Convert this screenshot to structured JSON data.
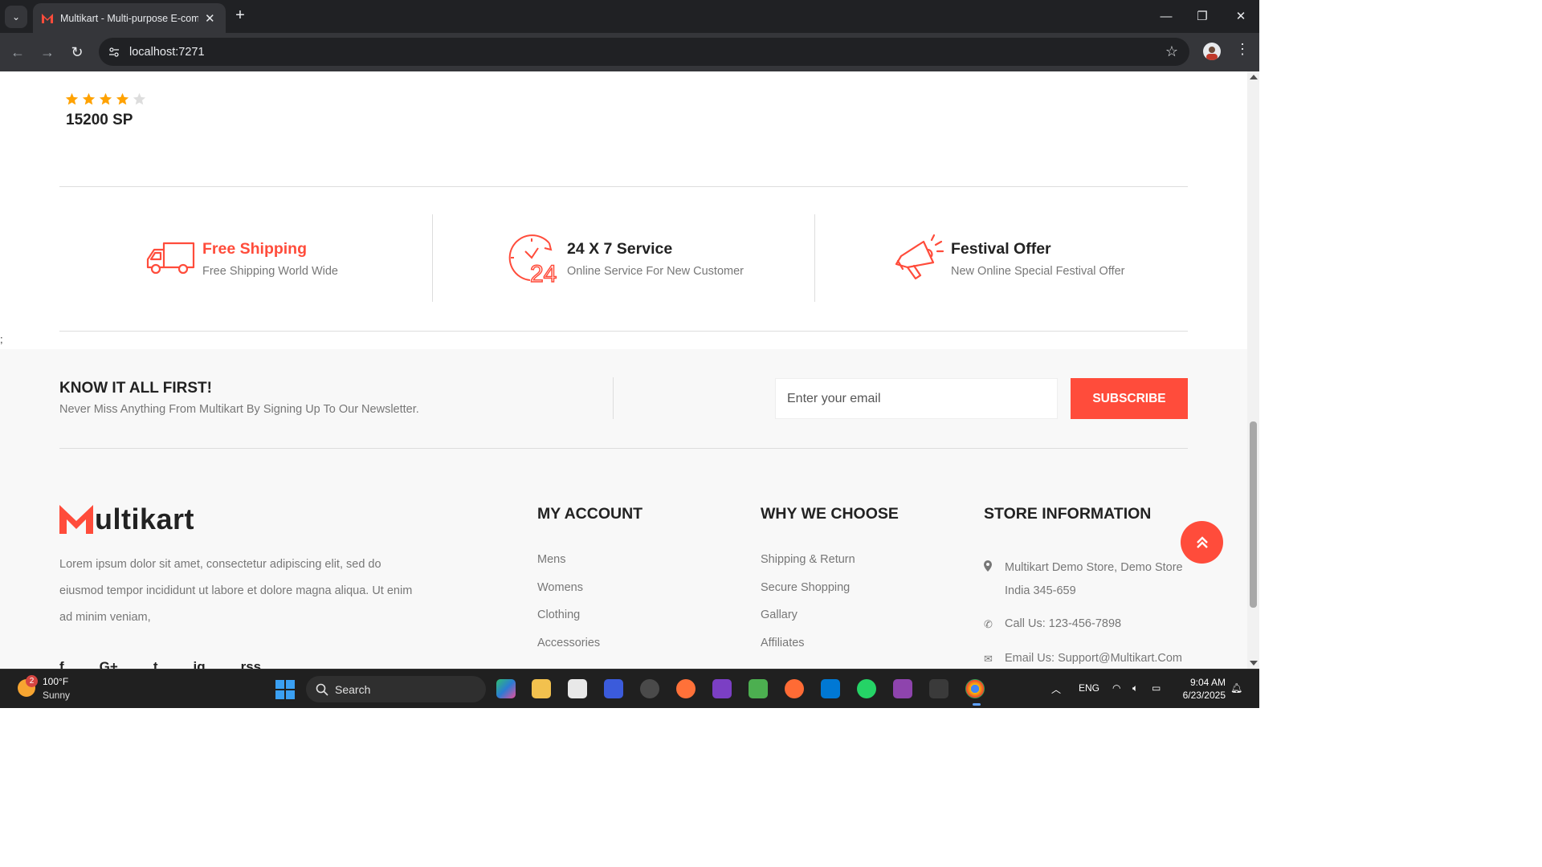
{
  "browser": {
    "tab_title": "Multikart - Multi-purpose E-commerce",
    "url": "localhost:7271",
    "tab_close": "✕",
    "new_tab": "+",
    "minimize": "—",
    "restore": "❐",
    "close": "✕"
  },
  "product": {
    "rating": 4,
    "max_rating": 5,
    "price": "15200 SP",
    "star_color": "#ffa200"
  },
  "services": [
    {
      "title": "Free Shipping",
      "desc": "Free Shipping World Wide",
      "icon": "truck-icon"
    },
    {
      "title": "24 X 7 Service",
      "desc": "Online Service For New Customer",
      "icon": "clock-24-icon"
    },
    {
      "title": "Festival Offer",
      "desc": "New Online Special Festival Offer",
      "icon": "megaphone-icon"
    }
  ],
  "stray_text": ";",
  "newsletter": {
    "title": "KNOW IT ALL FIRST!",
    "text": "Never Miss Anything From Multikart By Signing Up To Our Newsletter.",
    "placeholder": "Enter your email",
    "button": "SUBSCRIBE"
  },
  "footer": {
    "logo_text": "ultikart",
    "about": "Lorem ipsum dolor sit amet, consectetur adipiscing elit, sed do eiusmod tempor incididunt ut labore et dolore magna aliqua. Ut enim ad minim veniam,",
    "socials": [
      "f",
      "G+",
      "t",
      "ig",
      "rss"
    ],
    "my_account": {
      "title": "MY ACCOUNT",
      "links": [
        "Mens",
        "Womens",
        "Clothing",
        "Accessories"
      ]
    },
    "why_we_choose": {
      "title": "WHY WE CHOOSE",
      "links": [
        "Shipping & Return",
        "Secure Shopping",
        "Gallary",
        "Affiliates"
      ]
    },
    "store_info": {
      "title": "STORE INFORMATION",
      "address": "Multikart Demo Store, Demo Store India 345-659",
      "phone": "Call Us: 123-456-7898",
      "email": "Email Us: Support@Multikart.Com"
    }
  },
  "theme": {
    "accent": "#ff4c3b"
  },
  "taskbar": {
    "weather_badge": "2",
    "temp": "100°F",
    "condition": "Sunny",
    "search": "Search",
    "lang": "ENG",
    "time": "9:04 AM",
    "date": "6/23/2025"
  }
}
